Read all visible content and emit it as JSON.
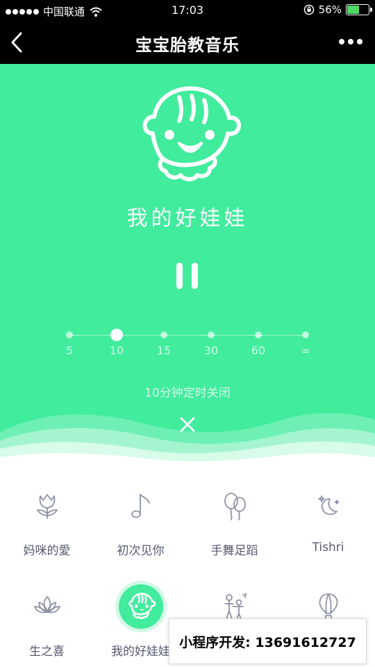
{
  "status_bar": {
    "carrier": "中国联通",
    "time": "17:03",
    "battery_percent": "56%",
    "battery_level": 0.56
  },
  "nav": {
    "title": "宝宝胎教音乐",
    "back_icon": "chevron-left-icon",
    "more_icon": "more-dots-icon"
  },
  "player": {
    "song_title": "我的好娃娃",
    "state": "playing",
    "timer": {
      "options": [
        "5",
        "10",
        "15",
        "30",
        "60",
        "∞"
      ],
      "selected": "10",
      "status": "10分钟定时关闭"
    }
  },
  "songs": [
    {
      "label": "妈咪的愛",
      "icon": "tulip-icon",
      "active": false
    },
    {
      "label": "初次见你",
      "icon": "music-note-icon",
      "active": false
    },
    {
      "label": "手舞足蹈",
      "icon": "balloons-icon",
      "active": false
    },
    {
      "label": "Tishri",
      "icon": "moon-stars-icon",
      "active": false
    },
    {
      "label": "生之喜",
      "icon": "lotus-icon",
      "active": false
    },
    {
      "label": "我的好娃娃",
      "icon": "baby-face-icon",
      "active": true
    },
    {
      "label": "",
      "icon": "family-icon",
      "active": false
    },
    {
      "label": "",
      "icon": "hot-air-balloon-icon",
      "active": false
    }
  ],
  "ad_banner": "小程序开发: 13691612727",
  "colors": {
    "accent": "#41ec9d",
    "icon": "#8e92a6",
    "text": "#555a6e"
  }
}
